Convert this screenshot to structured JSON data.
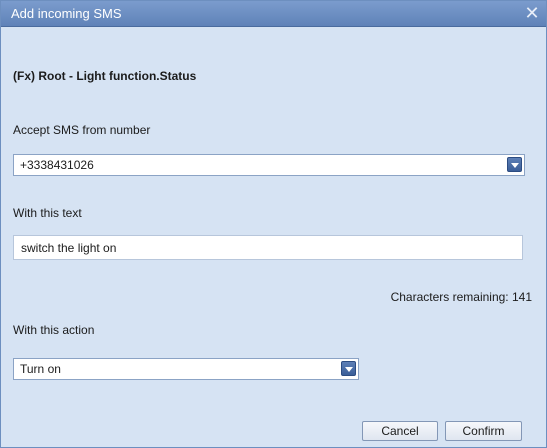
{
  "dialog": {
    "title": "Add incoming SMS",
    "close_icon": "close-icon"
  },
  "heading": "(Fx) Root - Light function.Status",
  "number_field": {
    "label": "Accept SMS from number",
    "value": "+3338431026"
  },
  "text_field": {
    "label": "With this text",
    "value": "switch the light on"
  },
  "remaining": "Characters remaining: 141",
  "action_field": {
    "label": "With this action",
    "value": "Turn on"
  },
  "buttons": {
    "cancel": "Cancel",
    "confirm": "Confirm"
  },
  "colors": {
    "titlebar": "#6a8cc2",
    "dialog_background": "#d6e3f3",
    "dropdown_button": "#3a5e98"
  }
}
